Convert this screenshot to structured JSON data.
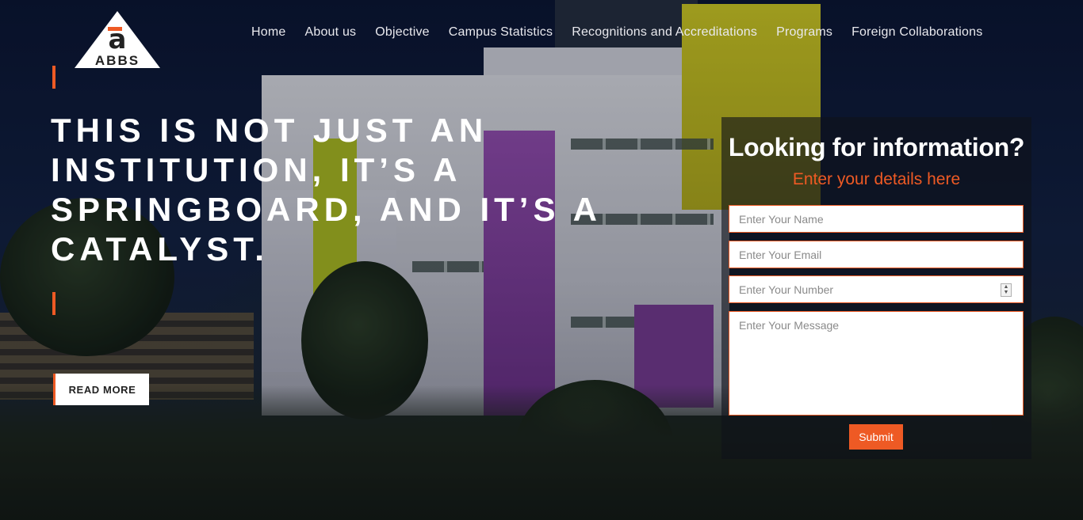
{
  "brand": {
    "logo_text": "ABBS",
    "accent_color": "#ee5a24"
  },
  "nav": {
    "items": [
      {
        "label": "Home"
      },
      {
        "label": "About us"
      },
      {
        "label": "Objective"
      },
      {
        "label": "Campus Statistics"
      },
      {
        "label": "Recognitions and Accreditations"
      },
      {
        "label": "Programs"
      },
      {
        "label": "Foreign Collaborations"
      }
    ]
  },
  "hero": {
    "headline": "THIS IS NOT JUST AN INSTITUTION, IT’S A SPRINGBOARD, AND IT’S A CATALYST.",
    "read_more_label": "READ MORE"
  },
  "form": {
    "title": "Looking for information?",
    "subtitle": "Enter your details here",
    "name_placeholder": "Enter Your Name",
    "email_placeholder": "Enter Your Email",
    "number_placeholder": "Enter Your Number",
    "message_placeholder": "Enter Your Message",
    "submit_label": "Submit"
  }
}
